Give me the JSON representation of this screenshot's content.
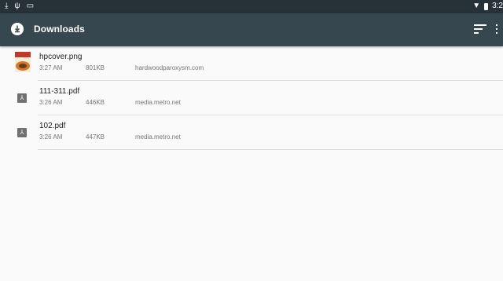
{
  "status_bar": {
    "left_icons": [
      "download-icon",
      "usb-icon",
      "image-icon"
    ],
    "time": "3:2"
  },
  "app_bar": {
    "title": "Downloads",
    "icons": [
      "download-circle-icon",
      "sort-icon",
      "overflow-menu-icon"
    ]
  },
  "downloads": [
    {
      "name": "hpcover.png",
      "time": "3:27 AM",
      "size": "801KB",
      "domain": "hardwoodparoxysm.com",
      "icon": "image-thumbnail"
    },
    {
      "name": "111-311.pdf",
      "time": "3:26 AM",
      "size": "446KB",
      "domain": "media.metro.net",
      "icon": "pdf-icon"
    },
    {
      "name": "102.pdf",
      "time": "3:26 AM",
      "size": "447KB",
      "domain": "media.metro.net",
      "icon": "pdf-icon"
    }
  ],
  "colors": {
    "status_bar": "#263238",
    "app_bar": "#37474f",
    "background": "#fafafa",
    "divider": "#e0e0e0"
  }
}
